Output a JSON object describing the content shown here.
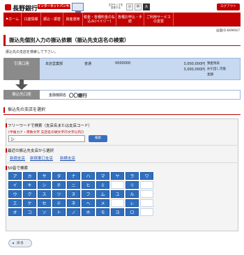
{
  "header": {
    "bank_name": "長野銀行",
    "service_label": "インターネットバンキング",
    "font_size_label": "文字サイズを変更する",
    "font_sizes": [
      "小",
      "中",
      "大"
    ],
    "logout_label": "ログアウト"
  },
  "nav": {
    "items": [
      "ホーム",
      "口座情報",
      "振込・振替",
      "資産運用",
      "税金・各種料金の払込み(ペイジー)",
      "各種お申込・手続",
      "ご利用サービスの変更"
    ]
  },
  "screen_id": "画面ID:BKM067",
  "page_title": "振込先個別入力の振込依頼（振込先支店名の検索）",
  "instruction": "振込先の支店を検索して下さい。",
  "source": {
    "label": "引落口座",
    "branch": "本店営業部",
    "account_type": "普通",
    "account_number": "0000000",
    "balance_amount": "3,000,000円",
    "available_amount": "3,000,000円",
    "balance_note": "預金残高",
    "available_note": "お引出し可能",
    "available_note2": "金額"
  },
  "destination": {
    "label": "振込先口座",
    "bank_label": "金融機関名",
    "bank_name": "〇〇銀行"
  },
  "branch_section_title": "振込先の支店を選択",
  "freeword": {
    "title": "フリーワードで検索（支店名または支店コード）",
    "hint": "(半角カナ・英数文字  支店名の頭文字(5文字以内))",
    "value": "シ",
    "button_label": "検索"
  },
  "recent": {
    "title": "最近の振込先支店から選択",
    "links": [
      "新宿支店",
      "新宿東口支店",
      "新横支店"
    ]
  },
  "kana_section_title": "50音で検索",
  "kana_rows": [
    [
      "ア",
      "カ",
      "サ",
      "タ",
      "ナ",
      "ハ",
      "マ",
      "ヤ",
      "ラ",
      "ワ"
    ],
    [
      "イ",
      "キ",
      "シ",
      "チ",
      "ニ",
      "ヒ",
      "ミ",
      "",
      "リ",
      ""
    ],
    [
      "ウ",
      "ク",
      "ス",
      "ツ",
      "ヌ",
      "フ",
      "ム",
      "ユ",
      "ル",
      ""
    ],
    [
      "エ",
      "ケ",
      "セ",
      "テ",
      "ネ",
      "ヘ",
      "メ",
      "",
      "レ",
      ""
    ],
    [
      "オ",
      "コ",
      "ソ",
      "ト",
      "ノ",
      "ホ",
      "モ",
      "ヨ",
      "ロ",
      ""
    ]
  ],
  "back_label": "戻る"
}
